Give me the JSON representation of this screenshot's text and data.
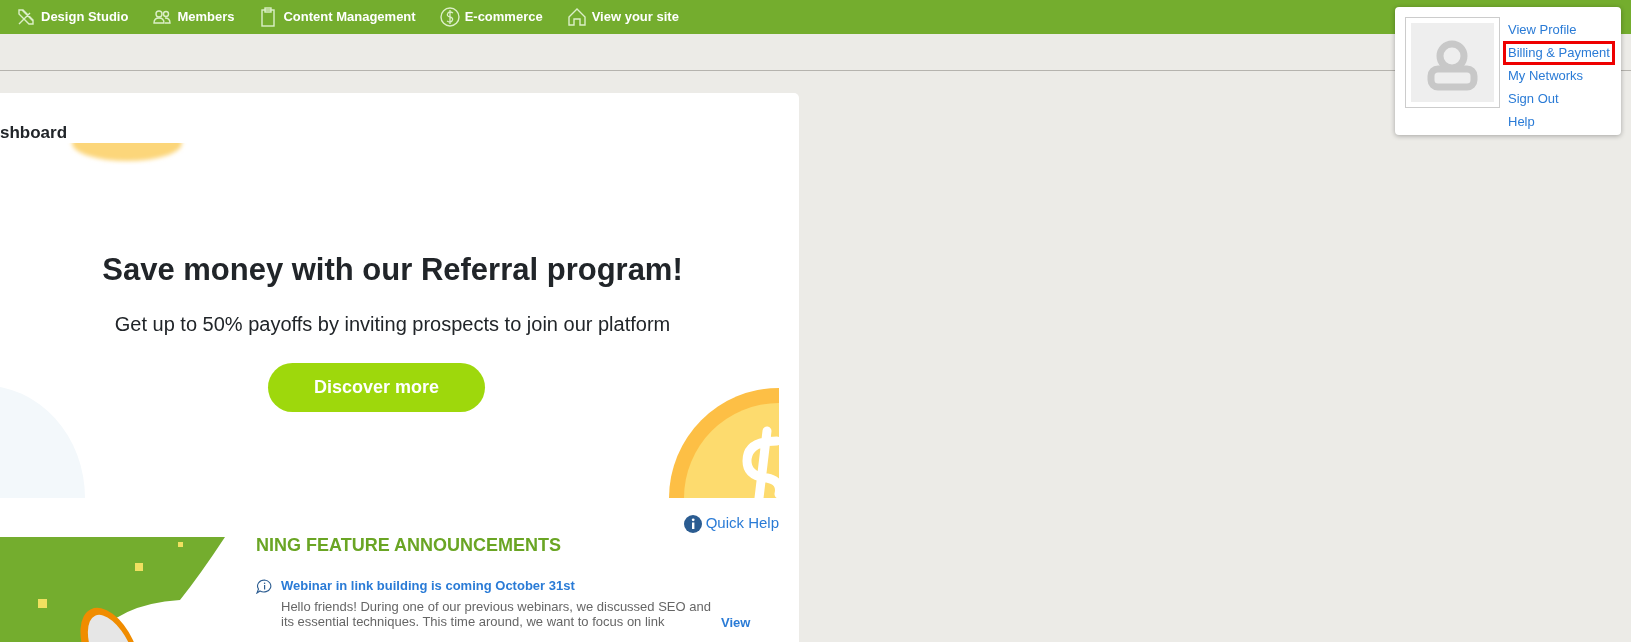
{
  "top_nav": [
    {
      "label": "Design Studio"
    },
    {
      "label": "Members"
    },
    {
      "label": "Content Management"
    },
    {
      "label": "E-commerce"
    },
    {
      "label": "View your site"
    }
  ],
  "dashboard": {
    "title": "shboard",
    "banner": {
      "heading": "Save money with our Referral program!",
      "subheading": "Get up to 50% payoffs by inviting prospects to join our platform",
      "button": "Discover more"
    },
    "quick_help": "Quick Help",
    "announcements": {
      "title": "NING FEATURE ANNOUNCEMENTS",
      "items": [
        {
          "title": "Webinar in link building is coming October 31st",
          "excerpt": "Hello friends!   During one of our previous webinars, we discussed SEO and its essential techniques. This time around, we want to focus on link",
          "link": "View"
        }
      ]
    }
  },
  "profile_menu": {
    "items": [
      {
        "label": "View Profile",
        "selected": false
      },
      {
        "label": "Billing & Payment",
        "selected": true
      },
      {
        "label": "My Networks",
        "selected": false
      },
      {
        "label": "Sign Out",
        "selected": false
      },
      {
        "label": "Help",
        "selected": false
      }
    ]
  }
}
